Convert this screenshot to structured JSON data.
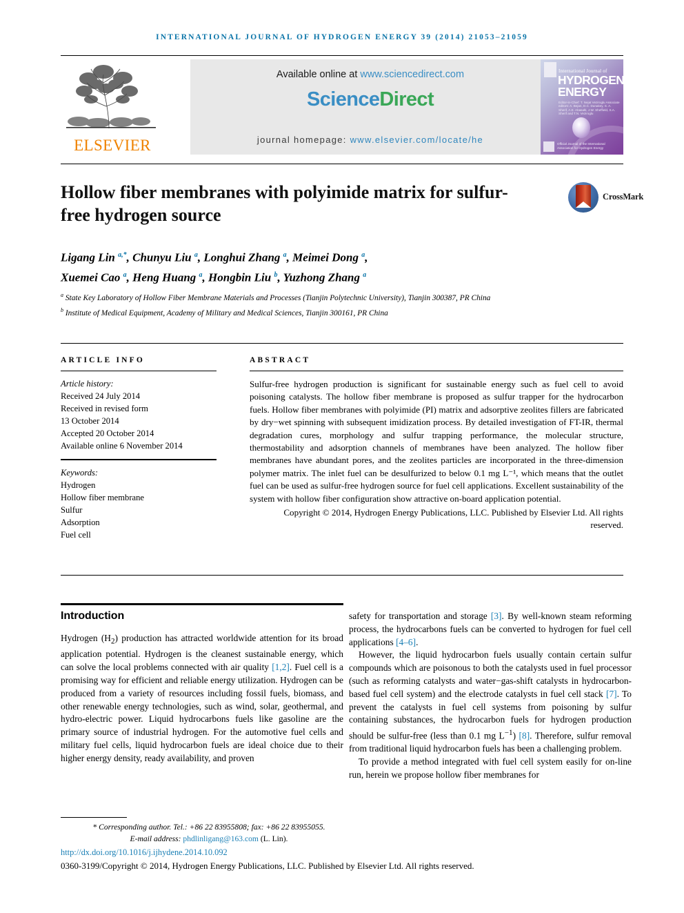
{
  "running_head": "INTERNATIONAL JOURNAL OF HYDROGEN ENERGY 39 (2014) 21053–21059",
  "masthead": {
    "publisher_name": "ELSEVIER",
    "available_online_prefix": "Available online at ",
    "sciencedirect_url": "www.sciencedirect.com",
    "sciencedirect_logo_part1": "Science",
    "sciencedirect_logo_part2": "Direct",
    "journal_homepage_label": "journal homepage: ",
    "journal_homepage_url": "www.elsevier.com/locate/he",
    "cover": {
      "line_small": "International Journal of",
      "line_big_1": "HYDROGEN",
      "line_big_2": "ENERGY",
      "editors": "Editor-in-Chief: T. Nejat Veziroglu   Associate editors: A. Bejan, D.C. Dunakey, S. A. Sherif, A.E. Abasalti, J.W. Sheffield, S.A. Sherif and T.N. Veziroglu",
      "bottom_note": "Official Journal of the International Association for Hydrogen Energy"
    }
  },
  "article": {
    "title": "Hollow fiber membranes with polyimide matrix for sulfur-free hydrogen source",
    "crossmark_label": "CrossMark",
    "authors_line_1": "Ligang Lin <sup>a,*</sup>, Chunyu Liu <sup>a</sup>, Longhui Zhang <sup>a</sup>, Meimei Dong <sup>a</sup>,",
    "authors_line_2": "Xuemei Cao <sup>a</sup>, Heng Huang <sup>a</sup>, Hongbin Liu <sup>b</sup>, Yuzhong Zhang <sup>a</sup>",
    "affiliation_a": "<sup>a</sup> State Key Laboratory of Hollow Fiber Membrane Materials and Processes (Tianjin Polytechnic University), Tianjin 300387, PR China",
    "affiliation_b": "<sup>b</sup> Institute of Medical Equipment, Academy of Military and Medical Sciences, Tianjin 300161, PR China"
  },
  "article_info": {
    "heading": "ARTICLE INFO",
    "history_label": "Article history:",
    "history": [
      "Received 24 July 2014",
      "Received in revised form",
      "13 October 2014",
      "Accepted 20 October 2014",
      "Available online 6 November 2014"
    ],
    "keywords_label": "Keywords:",
    "keywords": [
      "Hydrogen",
      "Hollow fiber membrane",
      "Sulfur",
      "Adsorption",
      "Fuel cell"
    ]
  },
  "abstract": {
    "heading": "ABSTRACT",
    "text": "Sulfur-free hydrogen production is significant for sustainable energy such as fuel cell to avoid poisoning catalysts. The hollow fiber membrane is proposed as sulfur trapper for the hydrocarbon fuels. Hollow fiber membranes with polyimide (PI) matrix and adsorptive zeolites fillers are fabricated by dry−wet spinning with subsequent imidization process. By detailed investigation of FT-IR, thermal degradation cures, morphology and sulfur trapping performance, the molecular structure, thermostability and adsorption channels of membranes have been analyzed. The hollow fiber membranes have abundant pores, and the zeolites particles are incorporated in the three-dimension polymer matrix. The inlet fuel can be desulfurized to below 0.1 mg L⁻¹, which means that the outlet fuel can be used as sulfur-free hydrogen source for fuel cell applications. Excellent sustainability of the system with hollow fiber configuration show attractive on-board application potential.",
    "copyright": "Copyright © 2014, Hydrogen Energy Publications, LLC. Published by Elsevier Ltd. All rights reserved."
  },
  "body": {
    "section_title": "Introduction",
    "left_par_1": "Hydrogen (H<sub>2</sub>) production has attracted worldwide attention for its broad application potential. Hydrogen is the cleanest sustainable energy, which can solve the local problems connected with air quality <span class=\"ref\">[1,2]</span>. Fuel cell is a promising way for efficient and reliable energy utilization. Hydrogen can be produced from a variety of resources including fossil fuels, biomass, and other renewable energy technologies, such as wind, solar, geothermal, and hydro-electric power. Liquid hydrocarbons fuels like gasoline are the primary source of industrial hydrogen. For the automotive fuel cells and military fuel cells, liquid hydrocarbon fuels are ideal choice due to their higher energy density, ready availability, and proven",
    "right_par_1": "safety for transportation and storage <span class=\"ref\">[3]</span>. By well-known steam reforming process, the hydrocarbons fuels can be converted to hydrogen for fuel cell applications <span class=\"ref\">[4–6]</span>.",
    "right_par_2": "However, the liquid hydrocarbon fuels usually contain certain sulfur compounds which are poisonous to both the catalysts used in fuel processor (such as reforming catalysts and water−gas-shift catalysts in hydrocarbon-based fuel cell system) and the electrode catalysts in fuel cell stack <span class=\"ref\">[7]</span>. To prevent the catalysts in fuel cell systems from poisoning by sulfur containing substances, the hydrocarbon fuels for hydrogen production should be sulfur-free (less than 0.1 mg L<sup>−1</sup>) <span class=\"ref\">[8]</span>. Therefore, sulfur removal from traditional liquid hydrocarbon fuels has been a challenging problem.",
    "right_par_3": "To provide a method integrated with fuel cell system easily for on-line run, herein we propose hollow fiber membranes for"
  },
  "footer": {
    "corresponding": "<span class=\"ital\">* Corresponding author. Tel.: +86 22 83955808; fax: +86 22 83955055.</span>",
    "email_label": "E-mail address: ",
    "email": "phdlinligang@163.com",
    "email_suffix": " (L. Lin).",
    "doi": "http://dx.doi.org/10.1016/j.ijhydene.2014.10.092",
    "issn_copyright": "0360-3199/Copyright © 2014, Hydrogen Energy Publications, LLC. Published by Elsevier Ltd. All rights reserved."
  },
  "colors": {
    "running_head_blue": "#0a74a8",
    "link_blue": "#1a7fb5",
    "sciencedirect_green": "#3aa757",
    "sciencedirect_blue": "#3a8ec4",
    "elsevier_orange": "#ef8200",
    "band_gray": "#e8e8e8"
  }
}
